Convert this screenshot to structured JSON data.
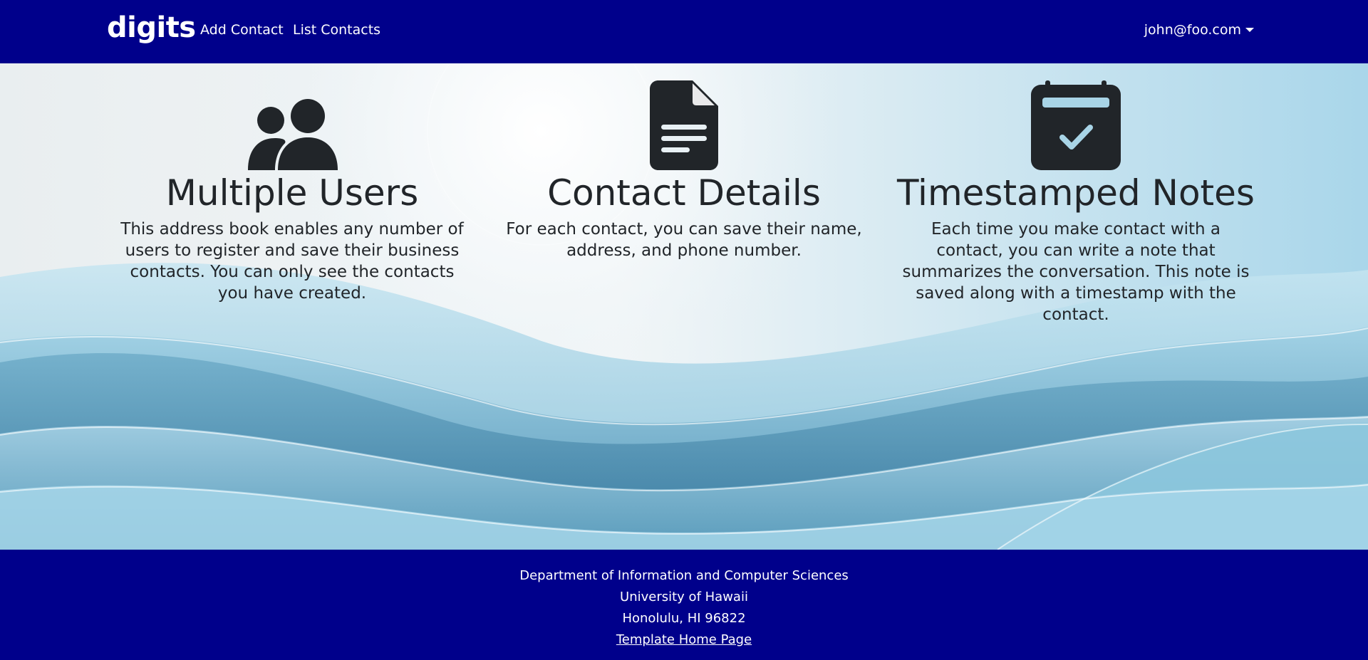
{
  "navbar": {
    "brand": "digits",
    "links": [
      {
        "label": "Add Contact"
      },
      {
        "label": "List Contacts"
      }
    ],
    "user": "john@foo.com",
    "background": "#00008b"
  },
  "features": [
    {
      "icon": "users-icon",
      "title": "Multiple Users",
      "description": "This address book enables any number of users to register and save their business contacts. You can only see the contacts you have created."
    },
    {
      "icon": "file-document-icon",
      "title": "Contact Details",
      "description": "For each contact, you can save their name, address, and phone number."
    },
    {
      "icon": "calendar-check-icon",
      "title": "Timestamped Notes",
      "description": "Each time you make contact with a contact, you can write a note that summarizes the conversation. This note is saved along with a timestamp with the contact."
    }
  ],
  "footer": {
    "lines": [
      "Department of Information and Computer Sciences",
      "University of Hawaii",
      "Honolulu, HI 96822"
    ],
    "link_label": "Template Home Page"
  }
}
